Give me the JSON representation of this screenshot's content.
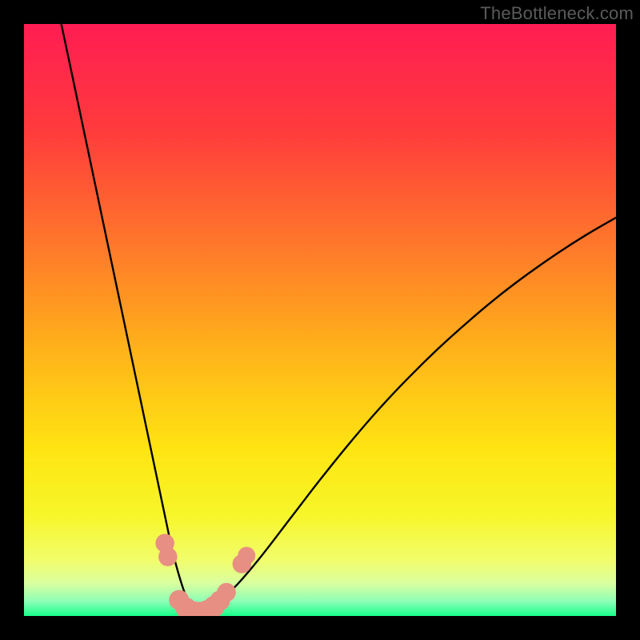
{
  "attribution": "TheBottleneck.com",
  "colors": {
    "frame": "#000000",
    "curve": "#000000",
    "marker_fill": "#e78f82",
    "marker_stroke": "#c56a5c",
    "gradient_stops": [
      {
        "offset": 0.0,
        "color": "#ff1d53"
      },
      {
        "offset": 0.18,
        "color": "#ff3b3c"
      },
      {
        "offset": 0.38,
        "color": "#ff7a2a"
      },
      {
        "offset": 0.55,
        "color": "#ffb21a"
      },
      {
        "offset": 0.72,
        "color": "#ffe512"
      },
      {
        "offset": 0.83,
        "color": "#f6f62a"
      },
      {
        "offset": 0.905,
        "color": "#f2fd6a"
      },
      {
        "offset": 0.945,
        "color": "#d9ffa0"
      },
      {
        "offset": 0.975,
        "color": "#8dffb6"
      },
      {
        "offset": 1.0,
        "color": "#18ff8a"
      }
    ]
  },
  "chart_data": {
    "type": "line",
    "title": "",
    "xlabel": "",
    "ylabel": "",
    "xlim": [
      0,
      100
    ],
    "ylim": [
      0,
      100
    ],
    "notes": "x and y are normalized to 0–100; the plot appears to be a bottleneck/percentage curve with a V-shaped minimum near x≈29 and y≈0. Scatter markers cluster near the valley floor.",
    "series": [
      {
        "name": "left-branch",
        "x": [
          6.3,
          8,
          10,
          12,
          14,
          16,
          18,
          20,
          22,
          24,
          25,
          26,
          27,
          28,
          29
        ],
        "y": [
          100,
          92,
          82.5,
          73,
          63.5,
          54,
          44.5,
          35,
          25.5,
          16,
          11.3,
          7.5,
          4.3,
          1.8,
          0.3
        ]
      },
      {
        "name": "right-branch",
        "x": [
          29,
          31,
          33,
          36,
          40,
          45,
          50,
          55,
          60,
          65,
          70,
          75,
          80,
          85,
          90,
          95,
          100
        ],
        "y": [
          0.3,
          1.0,
          2.5,
          5.3,
          10,
          16.5,
          23,
          29.2,
          35,
          40.3,
          45.2,
          49.7,
          53.9,
          57.7,
          61.2,
          64.4,
          67.3
        ]
      }
    ],
    "scatter": {
      "name": "markers",
      "points": [
        {
          "x": 23.8,
          "y": 12.3,
          "r": 1.0
        },
        {
          "x": 24.3,
          "y": 10.0,
          "r": 1.0
        },
        {
          "x": 26.2,
          "y": 2.7,
          "r": 1.1
        },
        {
          "x": 27.4,
          "y": 1.3,
          "r": 1.2
        },
        {
          "x": 28.6,
          "y": 0.7,
          "r": 1.2
        },
        {
          "x": 29.8,
          "y": 0.6,
          "r": 1.2
        },
        {
          "x": 31.0,
          "y": 0.9,
          "r": 1.2
        },
        {
          "x": 32.1,
          "y": 1.6,
          "r": 1.2
        },
        {
          "x": 33.1,
          "y": 2.6,
          "r": 1.1
        },
        {
          "x": 34.2,
          "y": 4.0,
          "r": 1.0
        },
        {
          "x": 36.8,
          "y": 8.8,
          "r": 1.0
        },
        {
          "x": 37.6,
          "y": 10.2,
          "r": 0.9
        }
      ]
    }
  }
}
